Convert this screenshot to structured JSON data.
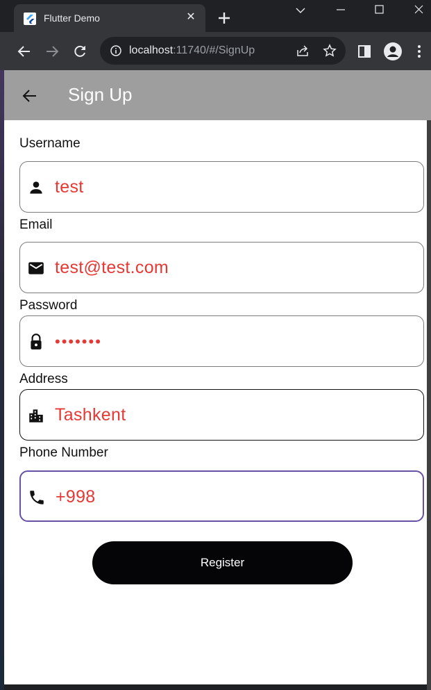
{
  "browser": {
    "tab_title": "Flutter Demo",
    "url_host": "localhost",
    "url_rest": ":11740/#/SignUp"
  },
  "app": {
    "title": "Sign Up",
    "fields": [
      {
        "label": "Username",
        "value": "test",
        "icon": "person-icon"
      },
      {
        "label": "Email",
        "value": "test@test.com",
        "icon": "mail-icon"
      },
      {
        "label": "Password",
        "value": "•••••••",
        "icon": "lock-icon"
      },
      {
        "label": "Address",
        "value": "Tashkent",
        "icon": "city-icon"
      },
      {
        "label": "Phone Number",
        "value": "+998",
        "icon": "phone-icon"
      }
    ],
    "register_label": "Register"
  },
  "colors": {
    "appbar": "#9e9e9e",
    "value_text": "#e53935",
    "focus_border": "#6750a4",
    "button": "#050508"
  }
}
